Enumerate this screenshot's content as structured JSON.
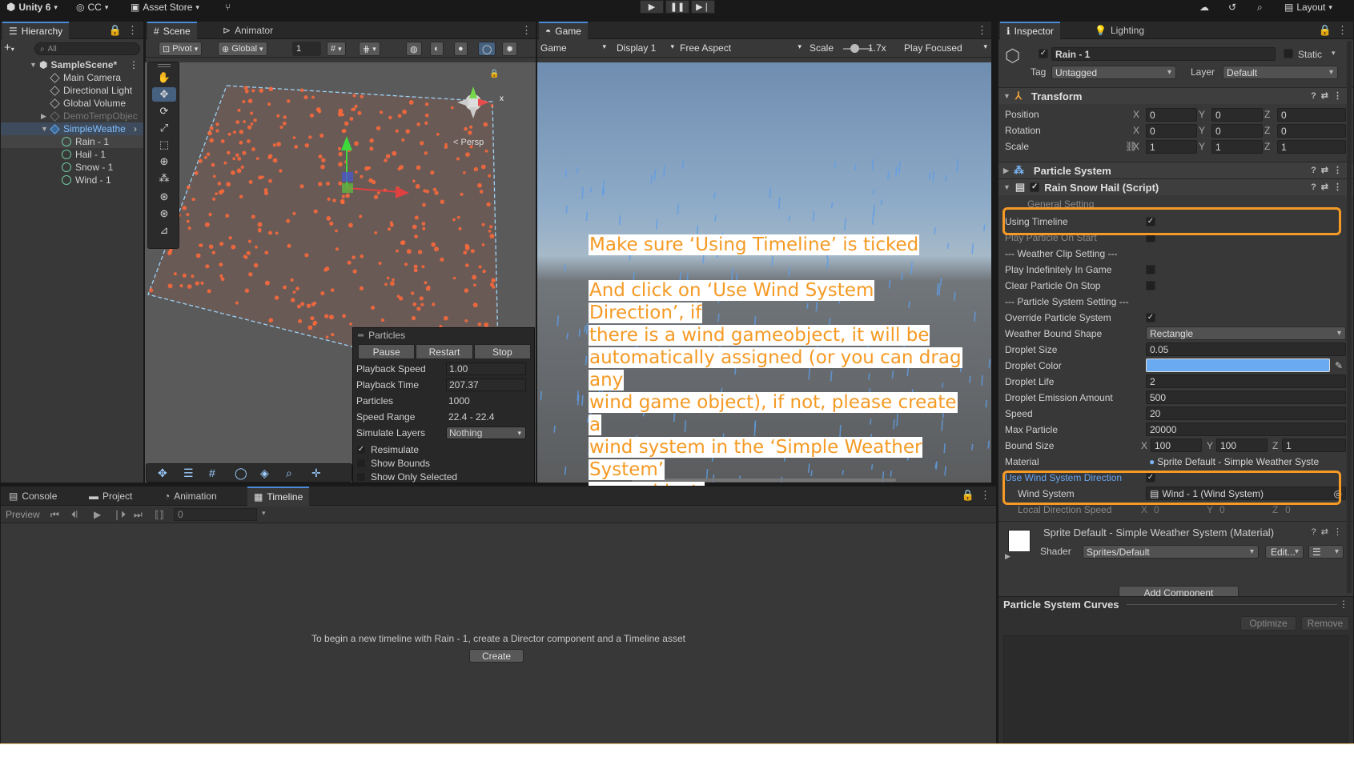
{
  "topbar": {
    "app_title": "Unity 6",
    "account": "CC",
    "asset_store": "Asset Store",
    "layout": "Layout"
  },
  "hierarchy": {
    "tab": "Hierarchy",
    "search_placeholder": "All",
    "items": [
      {
        "label": "SampleScene*"
      },
      {
        "label": "Main Camera"
      },
      {
        "label": "Directional Light"
      },
      {
        "label": "Global Volume"
      },
      {
        "label": "DemoTempObjec"
      },
      {
        "label": "SimpleWeathe"
      },
      {
        "label": "Rain - 1"
      },
      {
        "label": "Hail - 1"
      },
      {
        "label": "Snow - 1"
      },
      {
        "label": "Wind - 1"
      }
    ]
  },
  "scene": {
    "tab_scene": "Scene",
    "tab_animator": "Animator",
    "pivot": "Pivot",
    "global": "Global",
    "grid_value": "1",
    "persp": "< Persp",
    "gizmo_x": "x"
  },
  "particles_window": {
    "title": "Particles",
    "buttons": [
      "Pause",
      "Restart",
      "Stop"
    ],
    "rows": [
      {
        "label": "Playback Speed",
        "value": "1.00"
      },
      {
        "label": "Playback Time",
        "value": "207.37"
      },
      {
        "label": "Particles",
        "value": "1000"
      },
      {
        "label": "Speed Range",
        "value": "22.4 - 22.4"
      },
      {
        "label": "Simulate Layers",
        "value": "Nothing"
      }
    ],
    "checks": [
      {
        "label": "Resimulate",
        "checked": true
      },
      {
        "label": "Show Bounds",
        "checked": false
      },
      {
        "label": "Show Only Selected",
        "checked": false
      }
    ]
  },
  "game": {
    "tab": "Game",
    "mode": "Game",
    "display": "Display 1",
    "aspect": "Free Aspect",
    "scale_label": "Scale",
    "scale_value": "1.7x",
    "play_focused": "Play Focused"
  },
  "annotation": {
    "line1": "Make sure ‘Using Timeline’ is ticked",
    "para2": [
      "And click on ‘Use Wind System Direction’, if",
      "there is a wind gameobject, it will be",
      "automatically assigned (or you can drag any",
      "wind game object), if not, please create a",
      "wind system in the ‘Simple Weather System’",
      "gameobject."
    ],
    "color": "#f59a25"
  },
  "inspector": {
    "tab_inspector": "Inspector",
    "tab_lighting": "Lighting",
    "object_name": "Rain - 1",
    "static_label": "Static",
    "tag_label": "Tag",
    "tag_value": "Untagged",
    "layer_label": "Layer",
    "layer_value": "Default",
    "transform": {
      "title": "Transform",
      "position_label": "Position",
      "rotation_label": "Rotation",
      "scale_label": "Scale",
      "position": [
        "0",
        "0",
        "0"
      ],
      "rotation": [
        "0",
        "0",
        "0"
      ],
      "scale": [
        "1",
        "1",
        "1"
      ],
      "axes": [
        "X",
        "Y",
        "Z"
      ]
    },
    "particle_system_title": "Particle System",
    "script_title": "Rain Snow Hail (Script)",
    "general_setting": "General Setting",
    "fields": {
      "using_timeline": "Using Timeline",
      "play_particle_on_start": "Play Particle On Start",
      "weather_clip_setting": "--- Weather Clip Setting ---",
      "play_indefinitely": "Play Indefinitely In Game",
      "clear_particle_on_stop": "Clear Particle On Stop",
      "particle_system_setting": "--- Particle System Setting ---",
      "override_particle_system": "Override Particle System",
      "weather_bound_shape": "Weather Bound Shape",
      "weather_bound_shape_value": "Rectangle",
      "droplet_size": "Droplet Size",
      "droplet_size_value": "0.05",
      "droplet_color": "Droplet Color",
      "droplet_color_value": "#6aaaf0",
      "droplet_life": "Droplet Life",
      "droplet_life_value": "2",
      "droplet_emission": "Droplet Emission Amount",
      "droplet_emission_value": "500",
      "speed": "Speed",
      "speed_value": "20",
      "max_particle": "Max Particle",
      "max_particle_value": "20000",
      "bound_size": "Bound Size",
      "bound_size_values": [
        "100",
        "100",
        "1"
      ],
      "material": "Material",
      "material_value": "Sprite Default - Simple Weather Syste",
      "use_wind_direction": "Use Wind System Direction",
      "wind_system": "Wind System",
      "wind_system_value": "Wind - 1 (Wind System)",
      "local_direction_speed": "Local Direction Speed",
      "local_direction_values": [
        "0",
        "0",
        "0"
      ]
    },
    "material_card": {
      "title": "Sprite Default - Simple Weather System (Material)",
      "shader_label": "Shader",
      "shader_value": "Sprites/Default",
      "edit": "Edit..."
    },
    "add_component": "Add Component",
    "curves_title": "Particle System Curves",
    "optimize": "Optimize",
    "remove": "Remove"
  },
  "bottom": {
    "tabs": [
      "Console",
      "Project",
      "Animation",
      "Timeline"
    ],
    "preview": "Preview",
    "frame": "0",
    "message": "To begin a new timeline with Rain - 1, create a Director component and a Timeline asset",
    "create": "Create"
  }
}
